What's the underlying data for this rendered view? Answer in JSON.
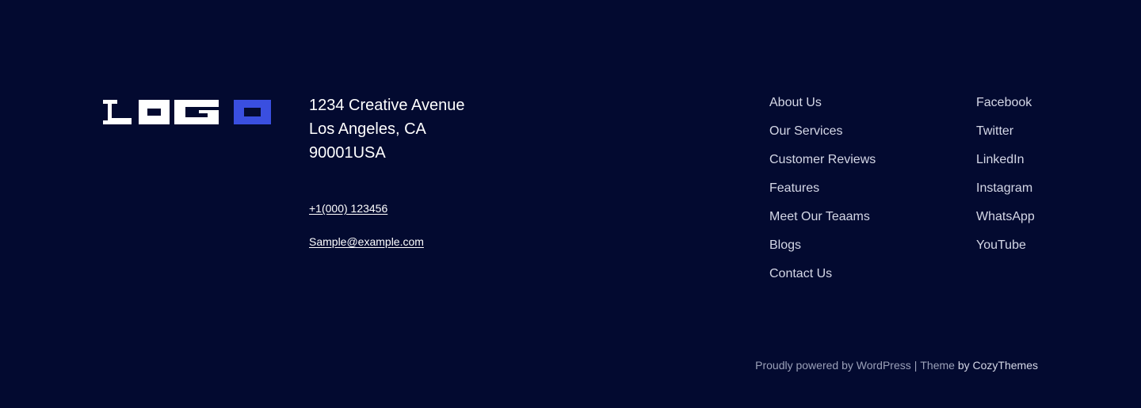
{
  "logo": {
    "text": "LOGO",
    "accent_color": "#3a4fe0",
    "text_color": "#ffffff"
  },
  "address": {
    "line1": "1234 Creative Avenue",
    "line2": "Los Angeles, CA",
    "line3": "90001USA"
  },
  "contact": {
    "phone": "+1(000) 123456",
    "email": "Sample@example.com"
  },
  "nav_menu": [
    "About Us",
    "Our Services",
    "Customer Reviews",
    "Features",
    "Meet Our Teaams",
    "Blogs",
    "Contact Us"
  ],
  "social_menu": [
    "Facebook",
    "Twitter",
    "LinkedIn",
    "Instagram",
    "WhatsApp",
    "YouTube"
  ],
  "credits": {
    "powered": "Proudly powered by WordPress",
    "separator": "|",
    "theme": "Theme",
    "by": "by CozyThemes"
  },
  "colors": {
    "background": "#030a30",
    "link_text": "#d4d7e6",
    "muted_text": "#9aa0b8"
  }
}
